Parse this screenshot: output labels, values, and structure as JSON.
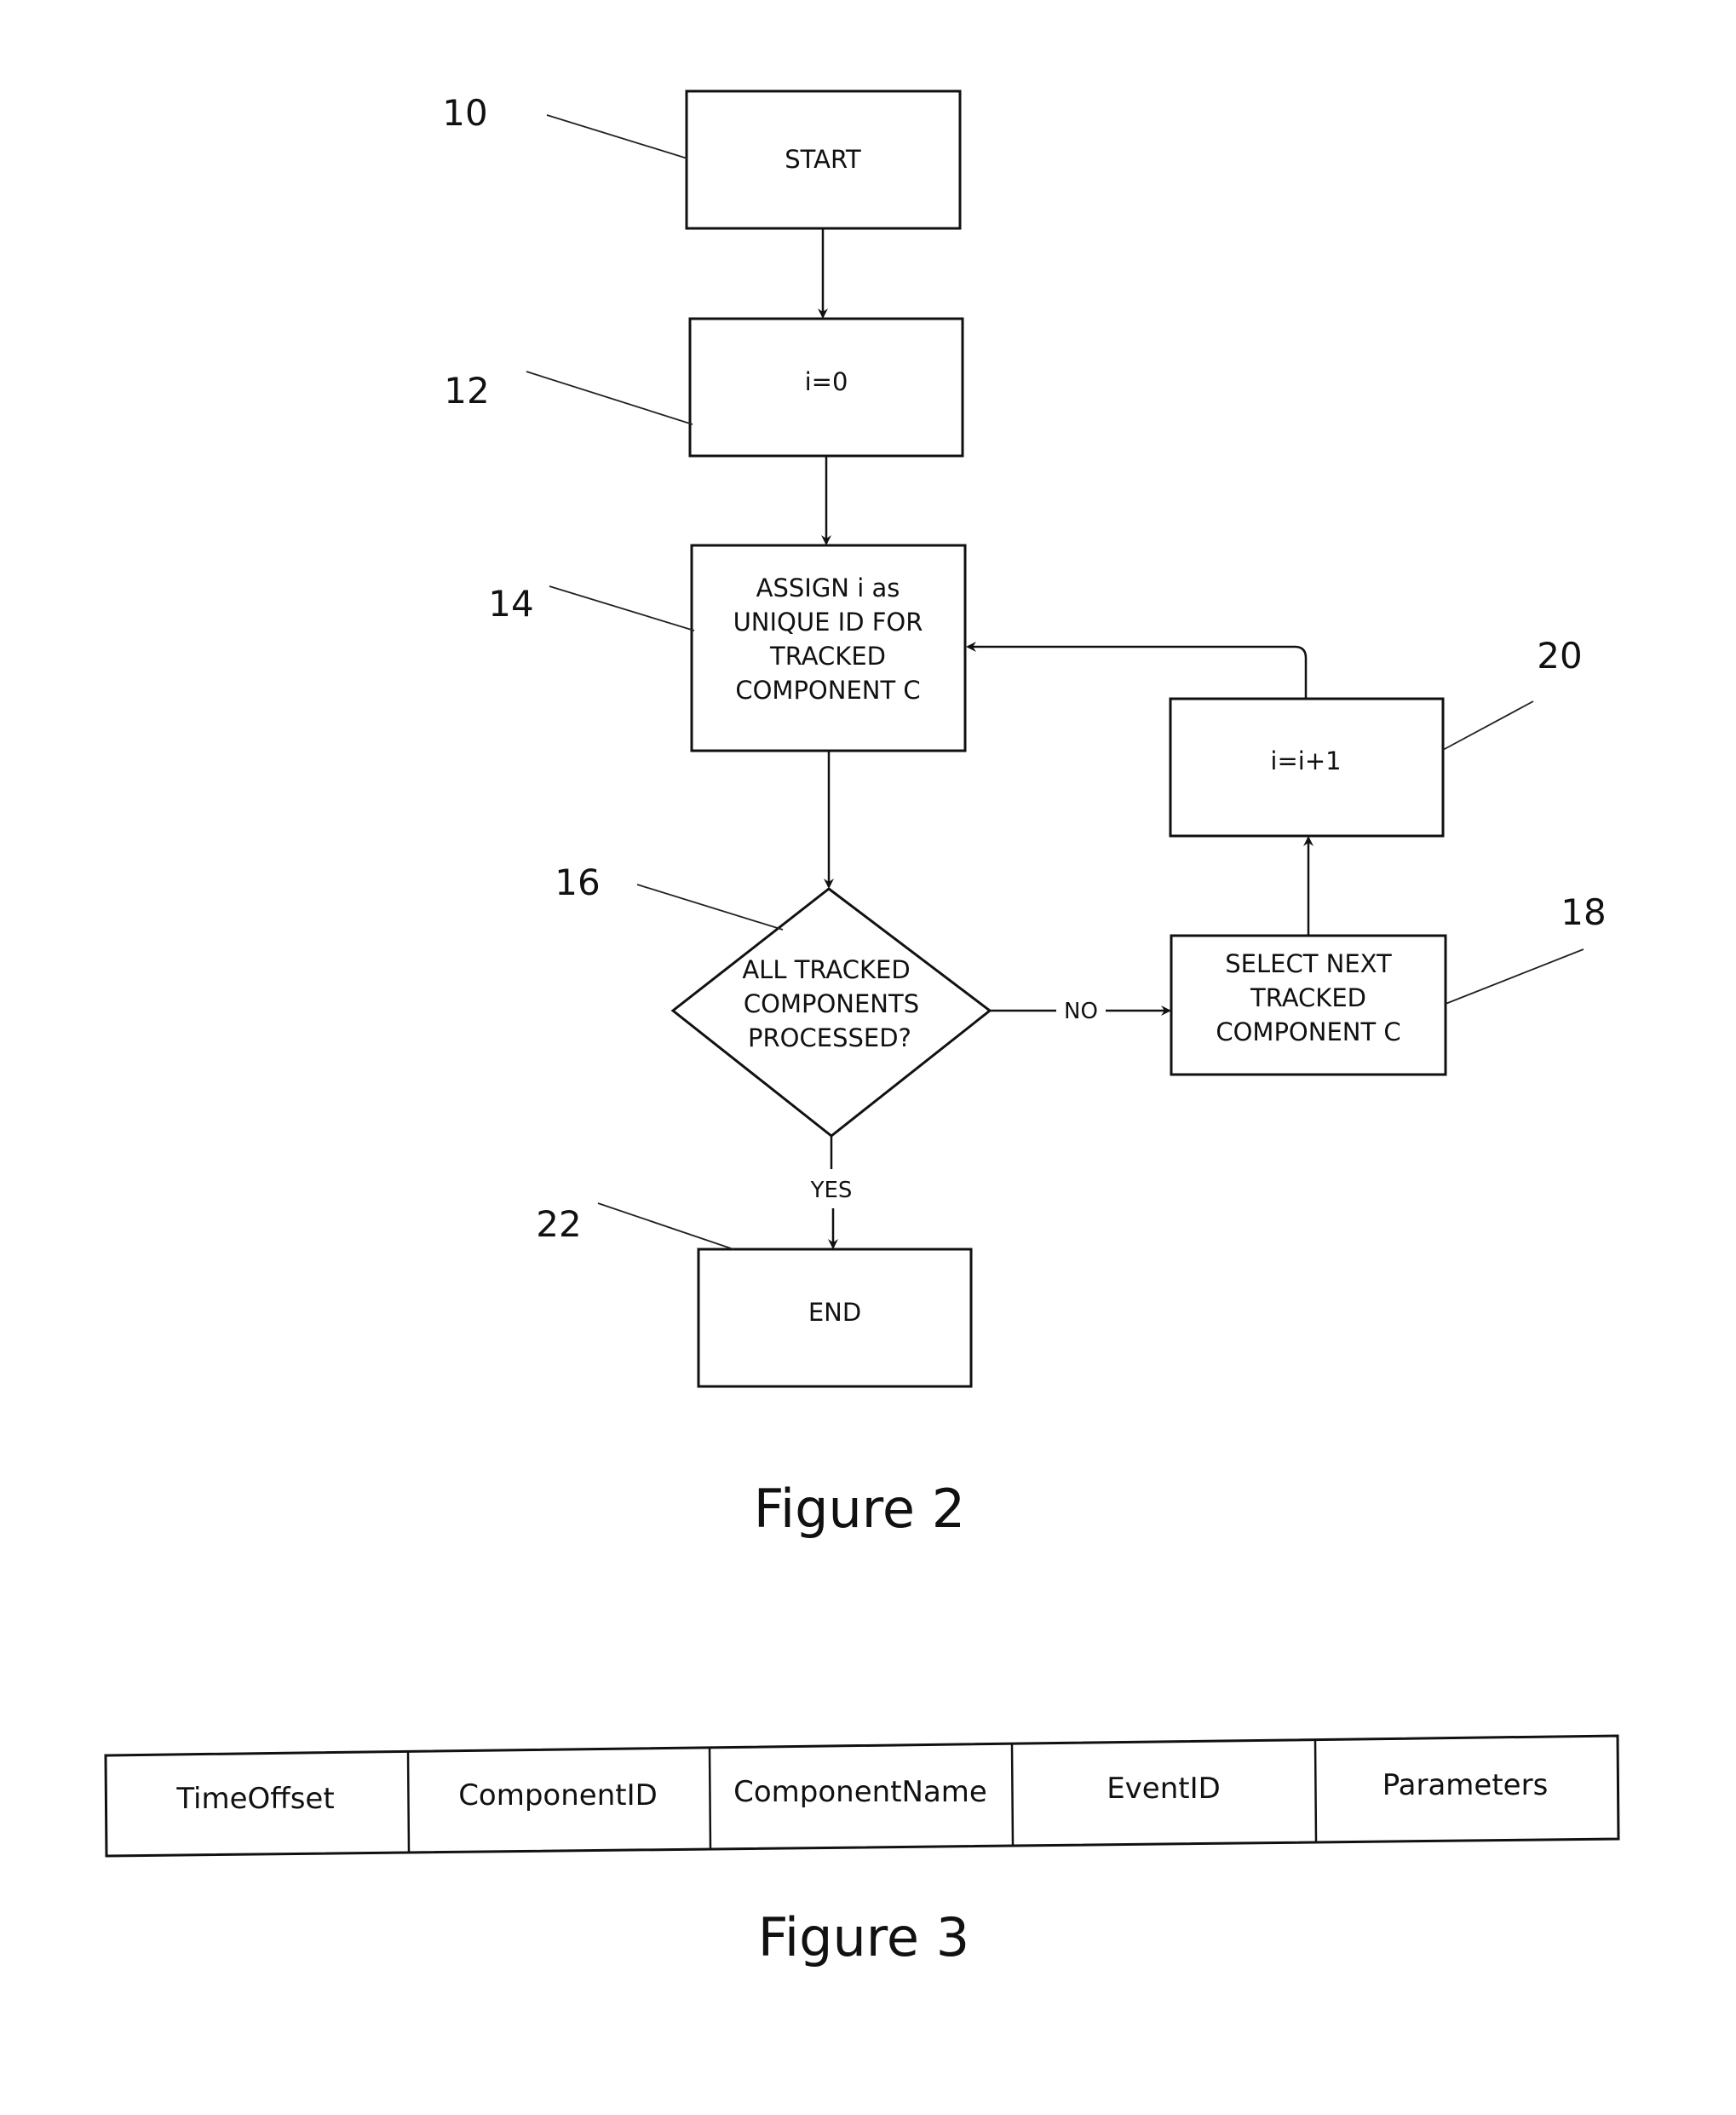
{
  "figure2": {
    "caption": "Figure 2",
    "nodes": {
      "start": {
        "ref": "10",
        "lines": [
          "START"
        ]
      },
      "init": {
        "ref": "12",
        "lines": [
          "i=0"
        ]
      },
      "assign": {
        "ref": "14",
        "lines": [
          "ASSIGN i as",
          "UNIQUE ID FOR",
          "TRACKED",
          "COMPONENT C"
        ]
      },
      "decision": {
        "ref": "16",
        "lines": [
          "ALL TRACKED",
          "COMPONENTS",
          "PROCESSED?"
        ]
      },
      "select_next": {
        "ref": "18",
        "lines": [
          "SELECT NEXT",
          "TRACKED",
          "COMPONENT C"
        ]
      },
      "increment": {
        "ref": "20",
        "lines": [
          "i=i+1"
        ]
      },
      "end": {
        "ref": "22",
        "lines": [
          "END"
        ]
      }
    },
    "edges": {
      "no_label": "NO",
      "yes_label": "YES"
    }
  },
  "figure3": {
    "caption": "Figure 3",
    "columns": [
      "TimeOffset",
      "ComponentID",
      "ComponentName",
      "EventID",
      "Parameters"
    ]
  }
}
